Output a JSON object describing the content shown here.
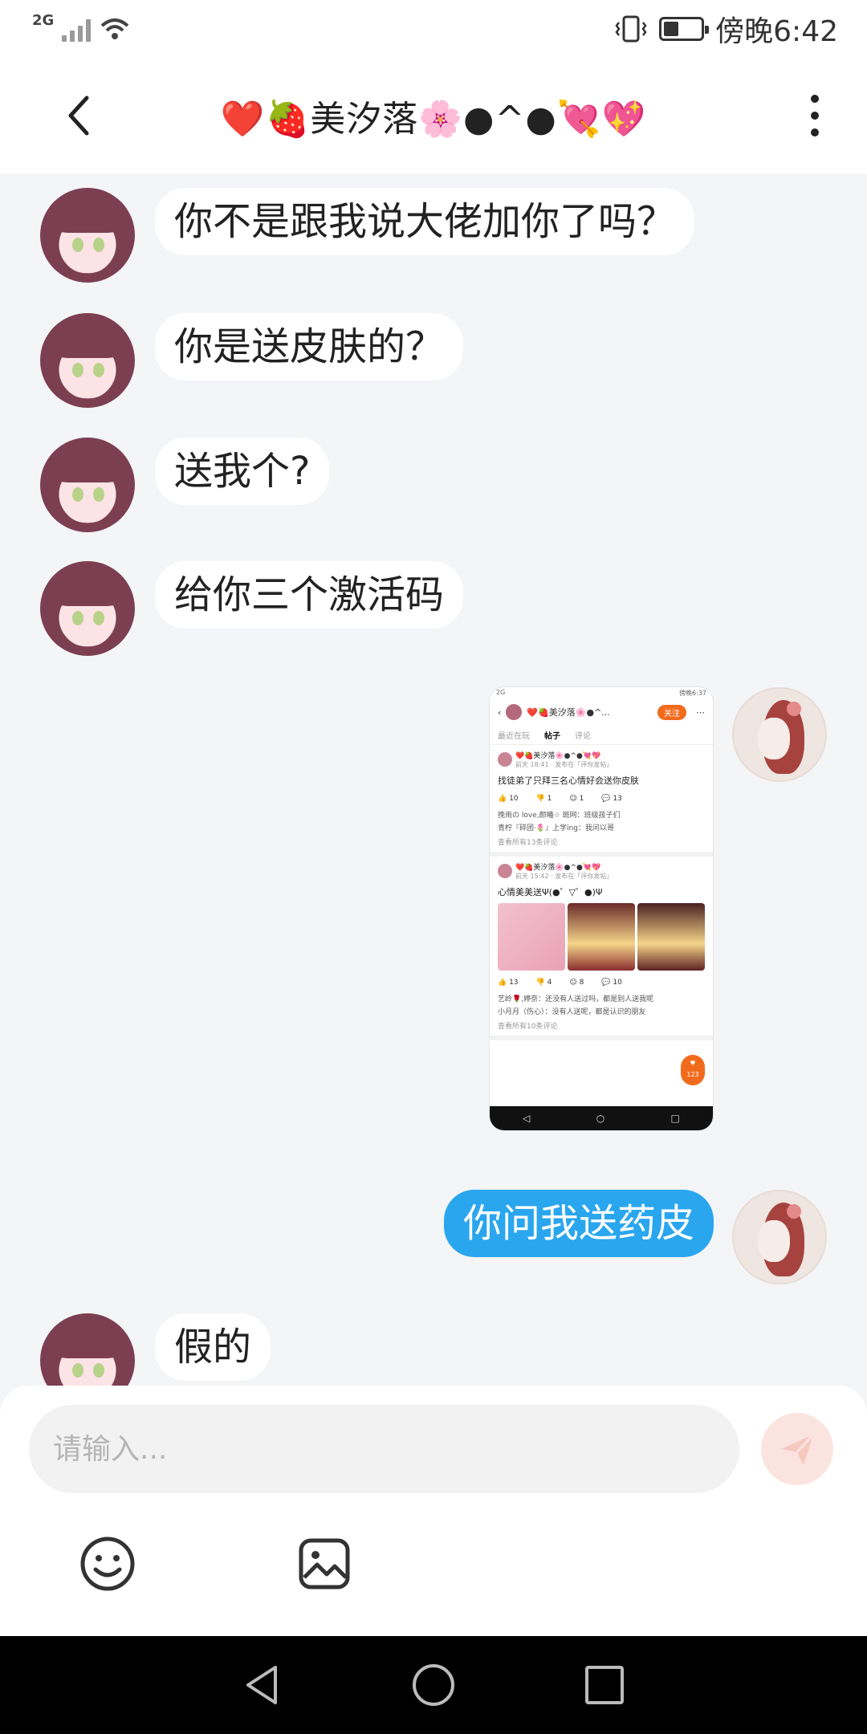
{
  "status_bar": {
    "network": "2G",
    "time": "傍晚6:42",
    "battery_level": 0.4
  },
  "header": {
    "title": "❤️🍓美汐落🌸●^●💘💖"
  },
  "messages": [
    {
      "side": "left",
      "text": "你不是跟我说大佬加你了吗？"
    },
    {
      "side": "left",
      "text": "你是送皮肤的？"
    },
    {
      "side": "left",
      "text": "送我个?"
    },
    {
      "side": "left",
      "text": "给你三个激活码"
    },
    {
      "side": "right",
      "type": "image",
      "screenshot": {
        "status_time": "傍晚6:37",
        "header_name": "❤️🍓美汐落🌸●^...",
        "follow_label": "关注",
        "tabs": [
          "最近在玩",
          "帖子",
          "评论"
        ],
        "posts": [
          {
            "author": "❤️🍓美汐落🌸●^●💘💖",
            "meta": "前天 18:41 · 发布在「评你发帖」",
            "text": "找徒弟了只拜三名心情好会送你皮肤",
            "likes": "10",
            "dislikes": "1",
            "react": "1",
            "comments": "13",
            "comment_lines": [
              "挽雨の love,颜曦☆ 斑网：班级孩子们",
              "青柠『碎团·🌷』上学ing：我问以哥"
            ],
            "more": "查看所有13条评论"
          },
          {
            "author": "❤️🍓美汐落🌸●^●💘💖",
            "meta": "前天 15:42 · 发布在「评你发帖」",
            "text": "心情美美送Ψ(●゜▽゜●)Ψ",
            "likes": "13",
            "dislikes": "4",
            "react": "8",
            "comments": "10",
            "comment_lines": [
              "艺岭🌹,婷奈：还没有人送过吗，都是别人送我呢",
              "小月月（伤心）：没有人送呢，都是认识的朋友"
            ],
            "more": "查看所有10条评论",
            "badge": "123"
          }
        ]
      }
    },
    {
      "side": "right",
      "text": "你问我送药皮"
    },
    {
      "side": "left",
      "text": "假的"
    }
  ],
  "composer": {
    "placeholder": "请输入..."
  }
}
